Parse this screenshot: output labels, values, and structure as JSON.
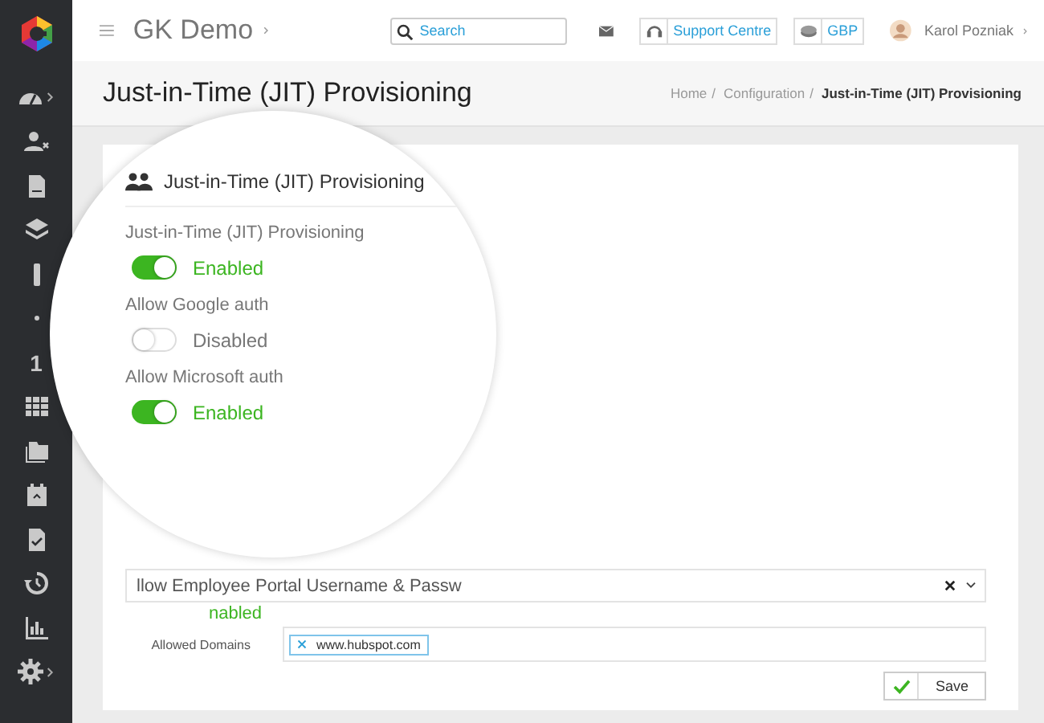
{
  "app": {
    "title": "GK Demo"
  },
  "sidebar": {
    "items": [
      {
        "kind": "dashboard",
        "expandable": true
      },
      {
        "kind": "user-x",
        "expandable": false
      },
      {
        "kind": "document",
        "expandable": false
      },
      {
        "kind": "layers",
        "expandable": false
      },
      {
        "kind": "bar",
        "expandable": false
      },
      {
        "kind": "dot",
        "expandable": false
      },
      {
        "kind": "digit",
        "label": "1",
        "expandable": false
      },
      {
        "kind": "table",
        "expandable": false
      },
      {
        "kind": "folders",
        "expandable": false
      },
      {
        "kind": "calendar",
        "expandable": false
      },
      {
        "kind": "doc-check",
        "expandable": false
      },
      {
        "kind": "history",
        "expandable": false
      },
      {
        "kind": "chart",
        "expandable": false
      },
      {
        "kind": "gear",
        "expandable": true
      }
    ]
  },
  "search": {
    "placeholder": "Search"
  },
  "header_buttons": [
    {
      "kind": "support",
      "label": "Support Centre"
    },
    {
      "kind": "currency",
      "label": "GBP"
    }
  ],
  "user": {
    "name": "Karol Pozniak"
  },
  "page": {
    "title": "Just-in-Time (JIT) Provisioning",
    "separator": "/",
    "breadcrumbs": [
      {
        "label": "Home",
        "current": false
      },
      {
        "label": "Configuration",
        "current": false
      },
      {
        "label": "Just-in-Time (JIT) Provisioning",
        "current": true
      }
    ]
  },
  "magnifier": {
    "section_title": "Just-in-Time (JIT) Provisioning",
    "settings": [
      {
        "label": "Just-in-Time (JIT) Provisioning",
        "on": true,
        "status": "Enabled"
      },
      {
        "label": "Allow Google auth",
        "on": false,
        "status": "Disabled"
      },
      {
        "label": "Allow Microsoft auth",
        "on": true,
        "status": "Enabled"
      }
    ]
  },
  "form": {
    "select": {
      "value": "llow Employee Portal Username & Passw"
    },
    "status_fragment": "nabled",
    "domains": {
      "label": "Allowed Domains",
      "tags": [
        "www.hubspot.com"
      ]
    },
    "save": "Save"
  }
}
